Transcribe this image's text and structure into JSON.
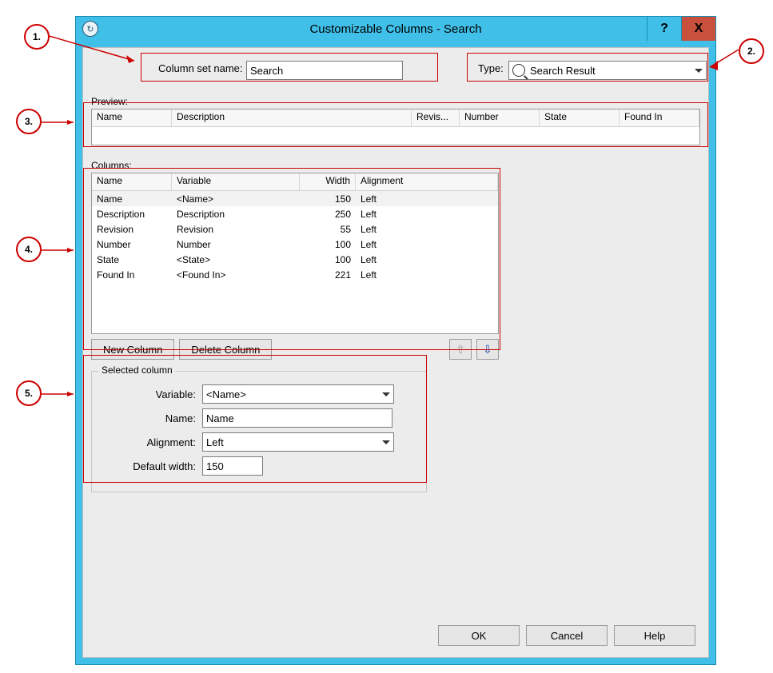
{
  "callouts": {
    "c1": "1.",
    "c2": "2.",
    "c3": "3.",
    "c4": "4.",
    "c5": "5."
  },
  "window": {
    "title": "Customizable Columns - Search",
    "help_glyph": "?",
    "close_glyph": "X",
    "refresh_glyph": "↻"
  },
  "top": {
    "colset_label": "Column set name:",
    "colset_value": "Search",
    "type_label": "Type:",
    "type_value": "Search Result"
  },
  "preview": {
    "caption": "Preview:",
    "headers": [
      "Name",
      "Description",
      "Revis...",
      "Number",
      "State",
      "Found In"
    ]
  },
  "columns": {
    "caption": "Columns:",
    "headers": {
      "name": "Name",
      "variable": "Variable",
      "width": "Width",
      "alignment": "Alignment"
    },
    "rows": [
      {
        "name": "Name",
        "variable": "<Name>",
        "width": "150",
        "align": "Left",
        "selected": true
      },
      {
        "name": "Description",
        "variable": "Description",
        "width": "250",
        "align": "Left"
      },
      {
        "name": "Revision",
        "variable": "Revision",
        "width": "55",
        "align": "Left"
      },
      {
        "name": "Number",
        "variable": "Number",
        "width": "100",
        "align": "Left"
      },
      {
        "name": "State",
        "variable": "<State>",
        "width": "100",
        "align": "Left"
      },
      {
        "name": "Found In",
        "variable": "<Found In>",
        "width": "221",
        "align": "Left"
      }
    ],
    "new_btn": "New Column",
    "del_btn": "Delete Column",
    "up_glyph": "⇧",
    "down_glyph": "⇩"
  },
  "selected": {
    "legend": "Selected column",
    "variable_label": "Variable:",
    "variable_value": "<Name>",
    "name_label": "Name:",
    "name_value": "Name",
    "align_label": "Alignment:",
    "align_value": "Left",
    "width_label": "Default width:",
    "width_value": "150"
  },
  "buttons": {
    "ok": "OK",
    "cancel": "Cancel",
    "help": "Help"
  }
}
